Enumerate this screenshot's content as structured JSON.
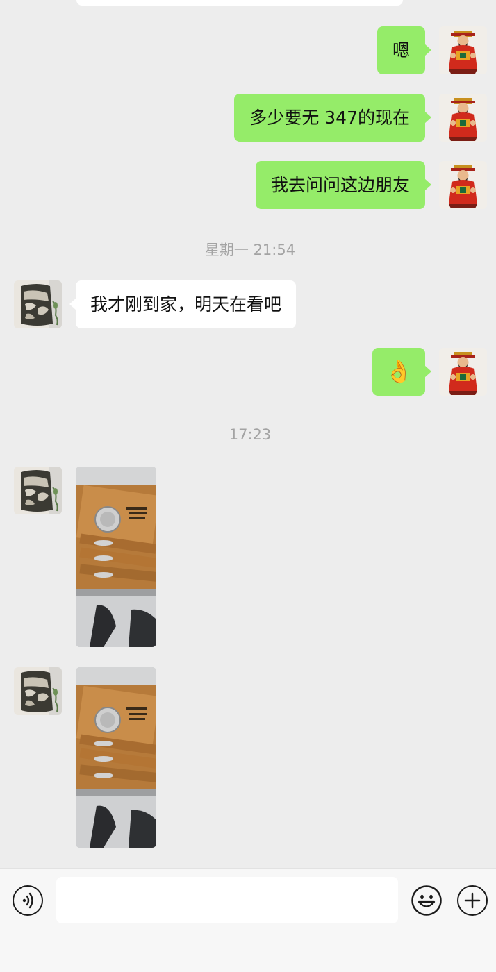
{
  "messages": [
    {
      "sender": "self",
      "text": "嗯"
    },
    {
      "sender": "self",
      "text": "多少要无 347的现在"
    },
    {
      "sender": "self",
      "text": "我去问问这边朋友"
    },
    {
      "sender": "system",
      "text": "星期一 21:54"
    },
    {
      "sender": "other",
      "text": "我才刚到家，明天在看吧"
    },
    {
      "sender": "self",
      "text": "👌"
    },
    {
      "sender": "system",
      "text": "17:23"
    },
    {
      "sender": "other",
      "type": "image",
      "icon": "photo-coin-cards"
    },
    {
      "sender": "other",
      "type": "image",
      "icon": "photo-coin-cards"
    }
  ],
  "input": {
    "value": "",
    "placeholder": ""
  },
  "icons": {
    "voice": "voice-icon",
    "emoji": "emoji-smile-icon",
    "more": "plus-icon",
    "self_avatar": "caishen-figure-avatar",
    "other_avatar": "vase-figure-avatar"
  },
  "colors": {
    "self_bubble": "#95ec69",
    "other_bubble": "#ffffff",
    "background": "#ededed",
    "timestamp": "#a3a3a3"
  }
}
